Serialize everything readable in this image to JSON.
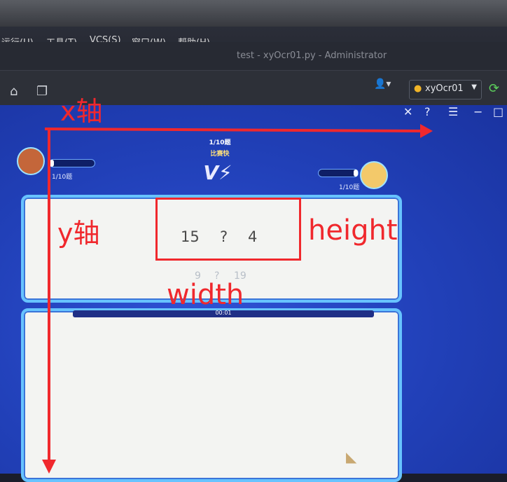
{
  "menu": {
    "items": [
      "运行(U)",
      "工具(T)",
      "VCS(S)",
      "窗口(W)",
      "帮助(H)"
    ],
    "window_title": "test - xyOcr01.py - Administrator"
  },
  "toolbar": {
    "user_label": "xyOcr01"
  },
  "game": {
    "round": "1/10题",
    "mode": "比赛快",
    "left_progress": "1/10题",
    "right_progress": "1/10题",
    "equation": {
      "left": "15",
      "op": "?",
      "right": "4"
    },
    "options": {
      "a": "9",
      "b": "?",
      "c": "19"
    },
    "timer": "00:01"
  },
  "annotations": {
    "x_axis": "x轴",
    "y_axis": "y轴",
    "height": "height",
    "width": "width"
  },
  "colors": {
    "annotation": "#f0282d",
    "game_bg": "#2140b8",
    "panel": "#f3f4f2"
  }
}
